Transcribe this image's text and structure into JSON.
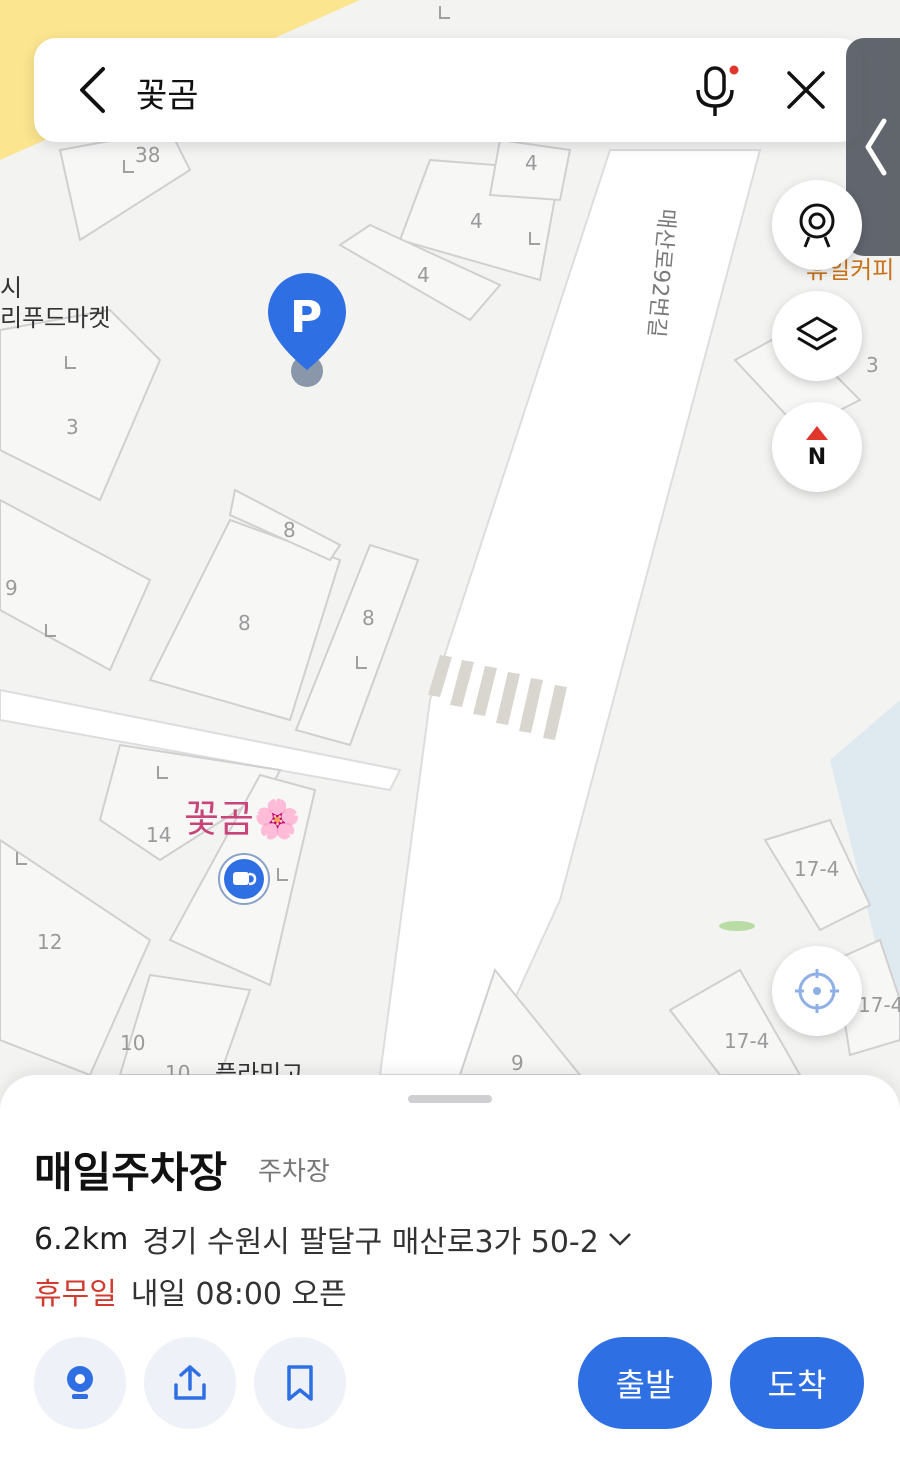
{
  "search": {
    "query": "꽃곰"
  },
  "map": {
    "road_label": "매산로92번길",
    "poi_left_partial_1": "시",
    "poi_left_partial_2": "리푸드마켓",
    "poi_cafe_partial": "휴일커피",
    "poi_bottom_partial": "플라밍고",
    "poi_flower": "꽃곰🌸",
    "building_numbers": [
      "38",
      "4",
      "4",
      "4",
      "3",
      "8",
      "8",
      "8",
      "9",
      "14",
      "12",
      "10",
      "10",
      "9",
      "17-4",
      "17-4",
      "17-4",
      "3"
    ]
  },
  "controls": {
    "compass_label": "N"
  },
  "sheet": {
    "place_name": "매일주차장",
    "category": "주차장",
    "distance": "6.2km",
    "address": "경기 수원시 팔달구 매산로3가 50-2",
    "status": "휴무일",
    "hours": "내일 08:00 오픈",
    "depart_label": "출발",
    "arrive_label": "도착"
  },
  "colors": {
    "accent": "#2f6fe4",
    "closed": "#d13a2e",
    "poi_pink": "#c8457a",
    "cafe_orange": "#c8741c"
  }
}
